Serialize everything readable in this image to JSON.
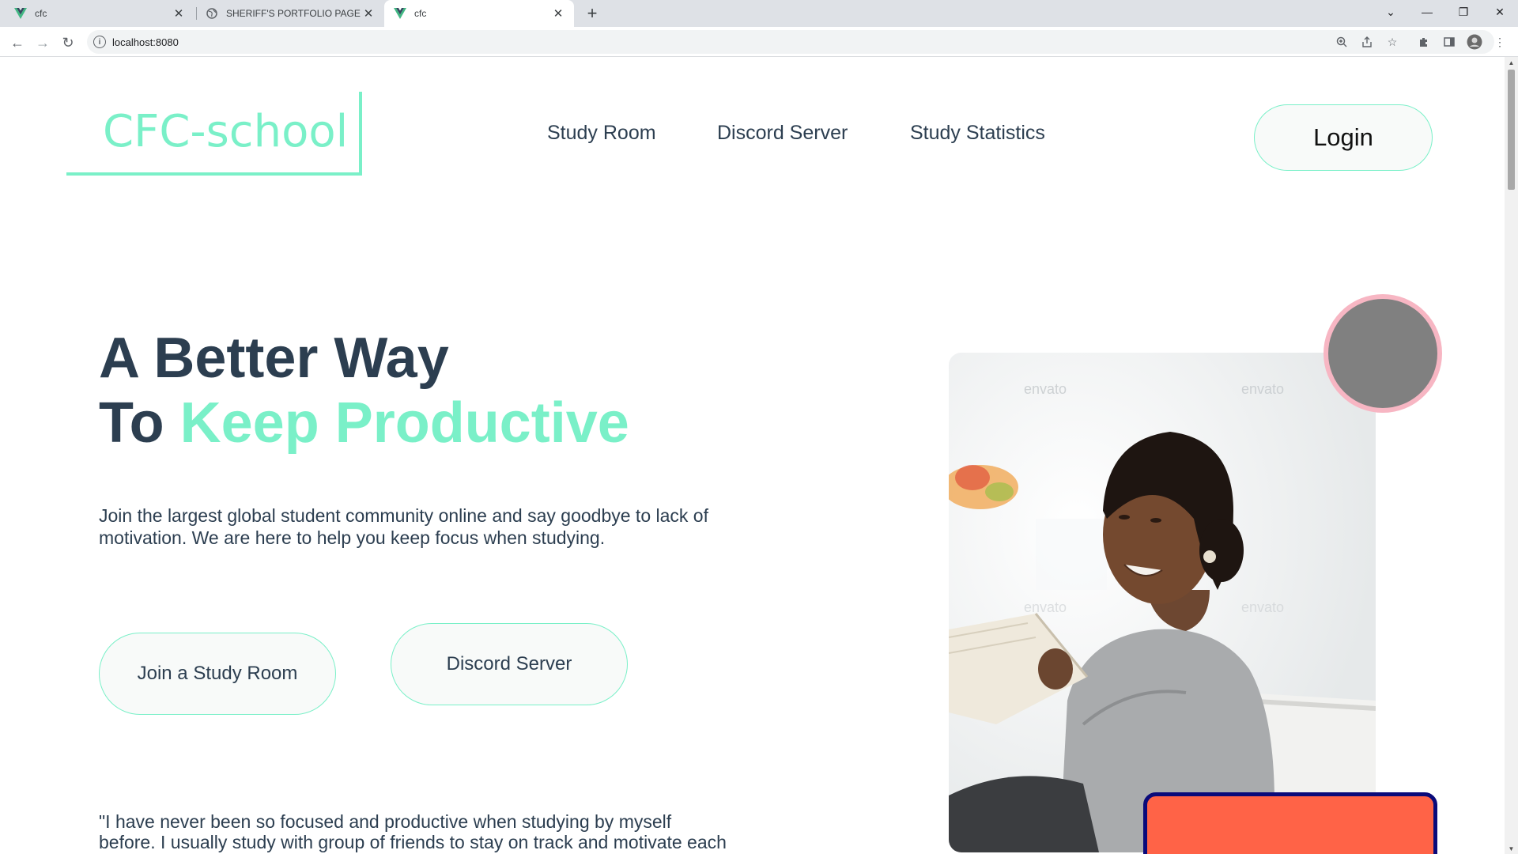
{
  "browser": {
    "tabs": [
      {
        "title": "cfc",
        "favicon": "vue-logo-icon",
        "active": false
      },
      {
        "title": "SHERIFF'S PORTFOLIO PAGE",
        "favicon": "globe-icon",
        "active": false
      },
      {
        "title": "cfc",
        "favicon": "vue-logo-icon",
        "active": true
      }
    ],
    "url": "localhost:8080"
  },
  "header": {
    "logo": "CFC-school",
    "nav": [
      "Study Room",
      "Discord Server",
      "Study Statistics"
    ],
    "login_label": "Login"
  },
  "hero": {
    "title_line1": "A Better Way",
    "title_line2_prefix": "To ",
    "title_line2_accent": "Keep Productive",
    "description": "Join the largest global student community online and say goodbye to lack of motivation. We are here to help you keep focus when studying.",
    "primary_button": "Join a Study Room",
    "secondary_button": "Discord Server",
    "testimonial": "\"I have never been so focused and productive when studying by myself before. I usually study with group of friends to stay on track and motivate each"
  },
  "image": {
    "watermark": "envato"
  },
  "colors": {
    "accent": "#7af0c8",
    "text": "#2c3e50",
    "circle": "#808080",
    "circle_border": "#f7b6c3",
    "card": "#ff6347",
    "card_border": "#0a0a7a"
  }
}
